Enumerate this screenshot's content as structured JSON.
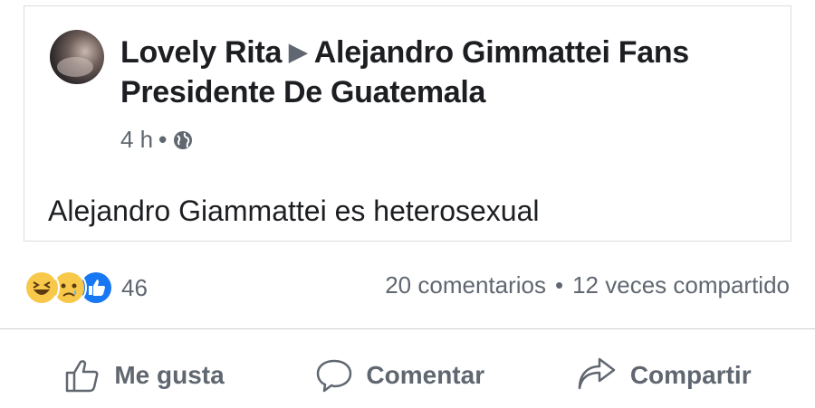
{
  "post": {
    "author": "Lovely Rita",
    "group": "Alejandro Gimmattei Fans Presidente De Guatemala",
    "time": "4 h",
    "dot": "•",
    "text": "Alejandro Giammattei es heterosexual",
    "privacy_icon": "globe-icon"
  },
  "engagement": {
    "reactions": [
      "haha-icon",
      "sad-icon",
      "like-icon"
    ],
    "reaction_count": "46",
    "comments": "20 comentarios",
    "separator": "•",
    "shares": "12 veces compartido"
  },
  "actions": {
    "like_label": "Me gusta",
    "comment_label": "Comentar",
    "share_label": "Compartir"
  },
  "colors": {
    "like_blue": "#1877f2",
    "emoji_yellow": "#f7c84a",
    "text_gray": "#606770"
  }
}
